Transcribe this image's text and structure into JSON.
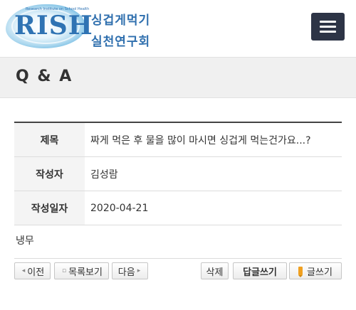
{
  "header": {
    "logo_letters": "RISH",
    "logo_tagline": "Research Institute on School Health",
    "logo_line1": "싱겁게먹기",
    "logo_line2": "실천연구회"
  },
  "page_title": "Q & A",
  "post": {
    "fields": [
      {
        "label": "제목",
        "value": "짜게 먹은 후 물을 많이 마시면 싱겁게 먹는건가요...?"
      },
      {
        "label": "작성자",
        "value": "김성람"
      },
      {
        "label": "작성일자",
        "value": "2020-04-21"
      }
    ],
    "body": "냉무"
  },
  "buttons": {
    "prev": "이전",
    "list": "목록보기",
    "next": "다음",
    "delete": "삭제",
    "reply": "답글쓰기",
    "write": "글쓰기"
  },
  "icons": {
    "prev": "chevron-left-icon",
    "list": "list-icon",
    "next": "chevron-right-icon",
    "write": "pencil-icon",
    "menu": "hamburger-icon"
  },
  "colors": {
    "menu_bg": "#2d3446",
    "logo_blue": "#2f73b3",
    "title_bar_bg": "#f0f0f0"
  }
}
